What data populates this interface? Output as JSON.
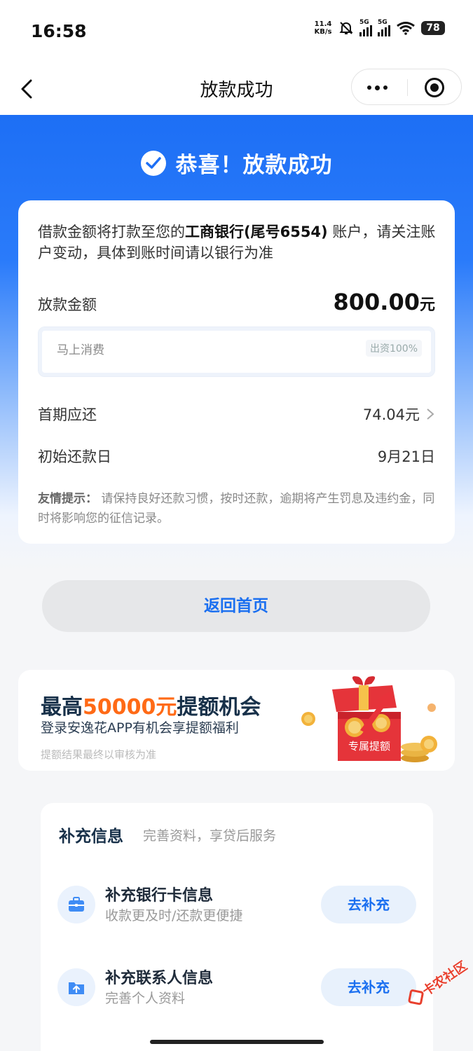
{
  "status_bar": {
    "time": "16:58",
    "net_speed_value": "11.4",
    "net_speed_unit": "KB/s",
    "sim1_label": "5G",
    "sim2_label": "5G",
    "battery": "78"
  },
  "nav": {
    "title": "放款成功"
  },
  "hero": {
    "success_text": "恭喜！放款成功"
  },
  "loan": {
    "notice_prefix": "借款金额将打款至您的",
    "bank": "工商银行(尾号6554)",
    "notice_suffix": "账户，请关注账户变动，具体到账时间请以银行为准",
    "amount_label": "放款金额",
    "amount_value": "800.00",
    "amount_unit": "元",
    "funder_name": "马上消费",
    "funder_share": "出资100%",
    "first_payment_label": "首期应还",
    "first_payment_value": "74.04元",
    "repay_date_label": "初始还款日",
    "repay_date_value": "9月21日",
    "tip_label": "友情提示：",
    "tip_text": "请保持良好还款习惯，按时还款，逾期将产生罚息及违约金，同时将影响您的征信记录。"
  },
  "actions": {
    "home_button": "返回首页"
  },
  "promo": {
    "title_prefix": "最高",
    "title_highlight": "50000元",
    "title_suffix": "提额机会",
    "subtitle": "登录安逸花APP有机会享提额福利",
    "note": "提额结果最终以审核为准",
    "gift_label": "专属提额"
  },
  "info": {
    "title": "补充信息",
    "subtitle": "完善资料，享贷后服务",
    "items": [
      {
        "name": "补充银行卡信息",
        "desc": "收款更及时/还款更便捷",
        "button": "去补充",
        "icon": "briefcase-icon"
      },
      {
        "name": "补充联系人信息",
        "desc": "完善个人资料",
        "button": "去补充",
        "icon": "upload-folder-icon"
      }
    ]
  },
  "watermark": {
    "text": "卡农社区"
  },
  "colors": {
    "brand_blue": "#1d6ff5",
    "link_blue": "#1a6ff0",
    "highlight_orange": "#ff6a16",
    "watermark_red": "#e8402e"
  }
}
